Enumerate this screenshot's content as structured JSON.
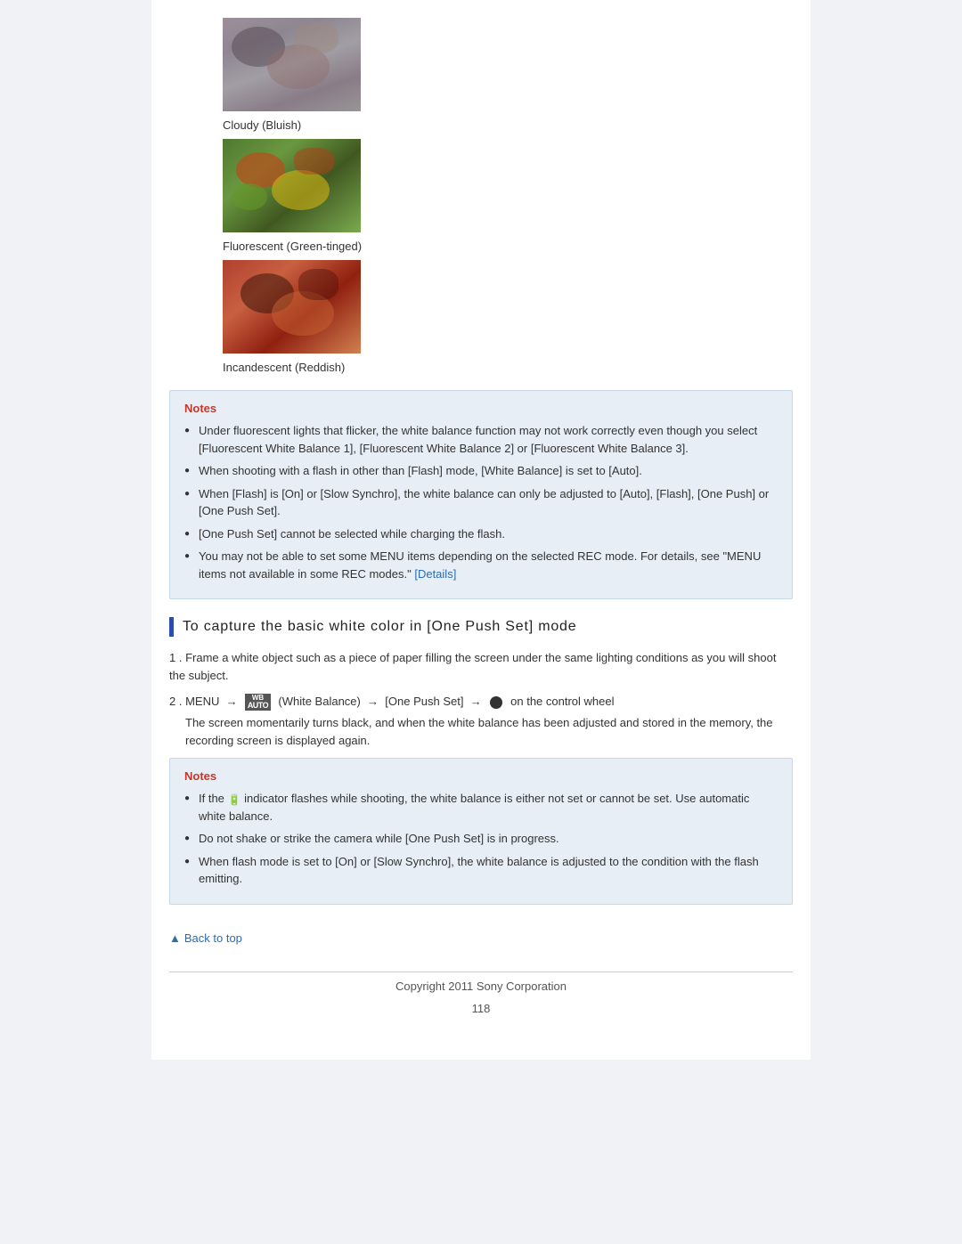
{
  "images": [
    {
      "id": "cloudy",
      "caption": "Cloudy (Bluish)",
      "type": "cloudy"
    },
    {
      "id": "fluorescent",
      "caption": "Fluorescent (Green-tinged)",
      "type": "fluorescent"
    },
    {
      "id": "incandescent",
      "caption": "Incandescent (Reddish)",
      "type": "incandescent"
    }
  ],
  "notes_section_1": {
    "title": "Notes",
    "items": [
      "Under fluorescent lights that flicker, the white balance function may not work correctly even though you select [Fluorescent White Balance 1], [Fluorescent White Balance 2] or [Fluorescent White Balance 3].",
      "When shooting with a flash in other than [Flash] mode, [White Balance] is set to [Auto].",
      "When [Flash] is [On] or [Slow Synchro], the white balance can only be adjusted to [Auto], [Flash], [One Push] or [One Push Set].",
      "[One Push Set] cannot be selected while charging the flash.",
      "You may not be able to set some MENU items depending on the selected REC mode. For details, see \"MENU items not available in some REC modes.\""
    ],
    "details_link_text": "[Details]"
  },
  "section_heading": "To capture the basic white color in [One Push Set] mode",
  "steps": [
    {
      "number": "1",
      "text": "Frame a white object such as a piece of paper filling the screen under the same lighting conditions as you will shoot the subject."
    },
    {
      "number": "2",
      "text": "MENU → WB AUTO (White Balance) → [One Push Set] → ● on the control wheel",
      "sub_text": "The screen momentarily turns black, and when the white balance has been adjusted and stored in the memory, the recording screen is displayed again."
    }
  ],
  "notes_section_2": {
    "title": "Notes",
    "items": [
      "If the indicator flashes while shooting, the white balance is either not set or cannot be set. Use automatic white balance.",
      "Do not shake or strike the camera while [One Push Set] is in progress.",
      "When flash mode is set to [On] or [Slow Synchro], the white balance is adjusted to the condition with the flash emitting."
    ]
  },
  "footer": {
    "back_to_top": "Back to top",
    "copyright": "Copyright 2011 Sony Corporation",
    "page_number": "118"
  }
}
